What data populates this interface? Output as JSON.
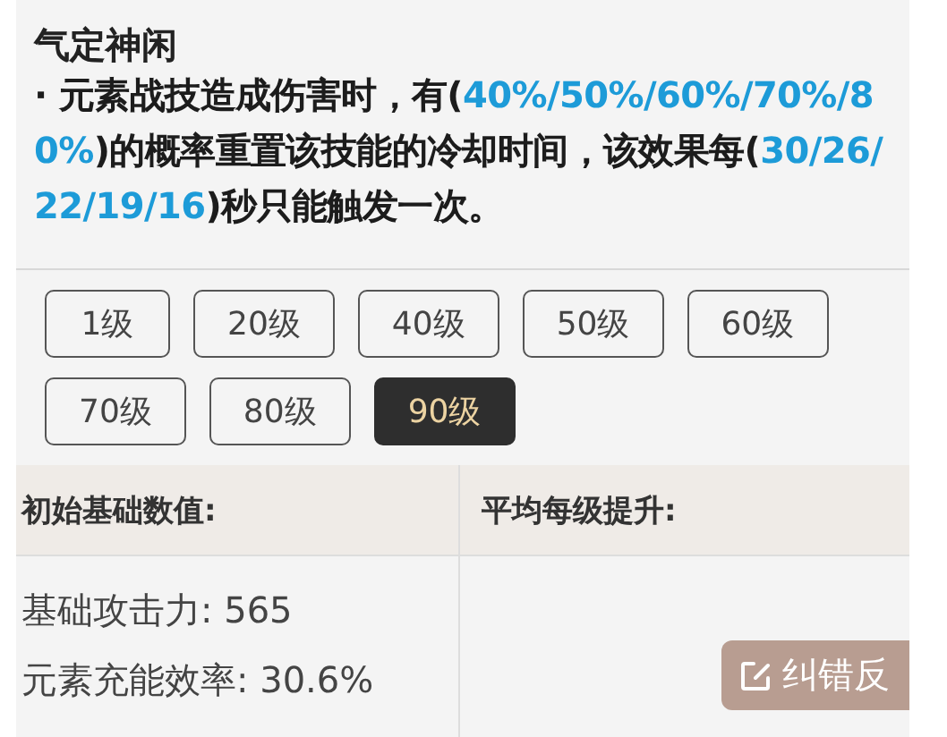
{
  "skill": {
    "title": "气定神闲",
    "description": [
      {
        "text": " · 元素战技造成伤害时，有(",
        "highlight": false
      },
      {
        "text": "40%/50%/60%/70%/80%",
        "highlight": true
      },
      {
        "text": ")的概率重置该技能的冷却时间，该效果每(",
        "highlight": false
      },
      {
        "text": "30/26/22/19/16",
        "highlight": true
      },
      {
        "text": ")秒只能触发一次。",
        "highlight": false
      }
    ]
  },
  "levels": [
    {
      "label": "1级",
      "selected": false
    },
    {
      "label": "20级",
      "selected": false
    },
    {
      "label": "40级",
      "selected": false
    },
    {
      "label": "50级",
      "selected": false
    },
    {
      "label": "60级",
      "selected": false
    },
    {
      "label": "70级",
      "selected": false
    },
    {
      "label": "80级",
      "selected": false
    },
    {
      "label": "90级",
      "selected": true
    }
  ],
  "stats": {
    "columns": [
      "初始基础数值:",
      "平均每级提升:"
    ],
    "base_values": [
      "基础攻击力: 565",
      "元素充能效率: 30.6%"
    ]
  },
  "feedback_button": {
    "label": "纠错反"
  }
}
